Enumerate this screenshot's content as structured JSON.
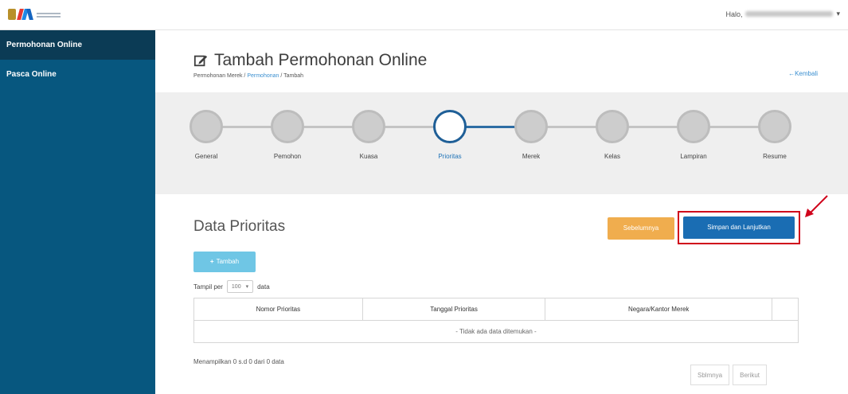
{
  "header": {
    "greeting": "Halo,",
    "user_menu_caret": "▾"
  },
  "sidebar": {
    "items": [
      {
        "label": "Permohonan Online",
        "active": true
      },
      {
        "label": "Pasca Online",
        "active": false
      }
    ]
  },
  "page": {
    "title": "Tambah Permohonan Online",
    "breadcrumb": {
      "root": "Permohonan Merek",
      "sep1": " / ",
      "link": "Permohonan",
      "sep2": " / ",
      "current": "Tambah"
    },
    "back_link": "Kembali",
    "back_arrow": "←"
  },
  "stepper": {
    "steps": [
      "General",
      "Pemohon",
      "Kuasa",
      "Prioritas",
      "Merek",
      "Kelas",
      "Lampiran",
      "Resume"
    ],
    "active_index": 3
  },
  "section": {
    "title": "Data Prioritas",
    "prev_button": "Sebelumnya",
    "next_button": "Simpan dan Lanjutkan",
    "add_button": "Tambah",
    "add_icon": "+"
  },
  "table_controls": {
    "show_prefix": "Tampil per",
    "page_size": "100",
    "show_suffix": "data"
  },
  "table": {
    "columns": [
      "Nomor Prioritas",
      "Tanggal Prioritas",
      "Negara/Kantor Merek",
      ""
    ],
    "empty_message": "- Tidak ada data ditemukan -"
  },
  "footer": {
    "info": "Menampilkan 0 s.d 0 dari 0 data",
    "prev_page": "Sblmnya",
    "next_page": "Berikut"
  },
  "colors": {
    "sidebar": "#07577f",
    "sidebar_active": "#0b3b55",
    "primary": "#1a6db3",
    "warning": "#f0ad4e",
    "info": "#6fc6e5",
    "highlight": "#d0021b"
  }
}
